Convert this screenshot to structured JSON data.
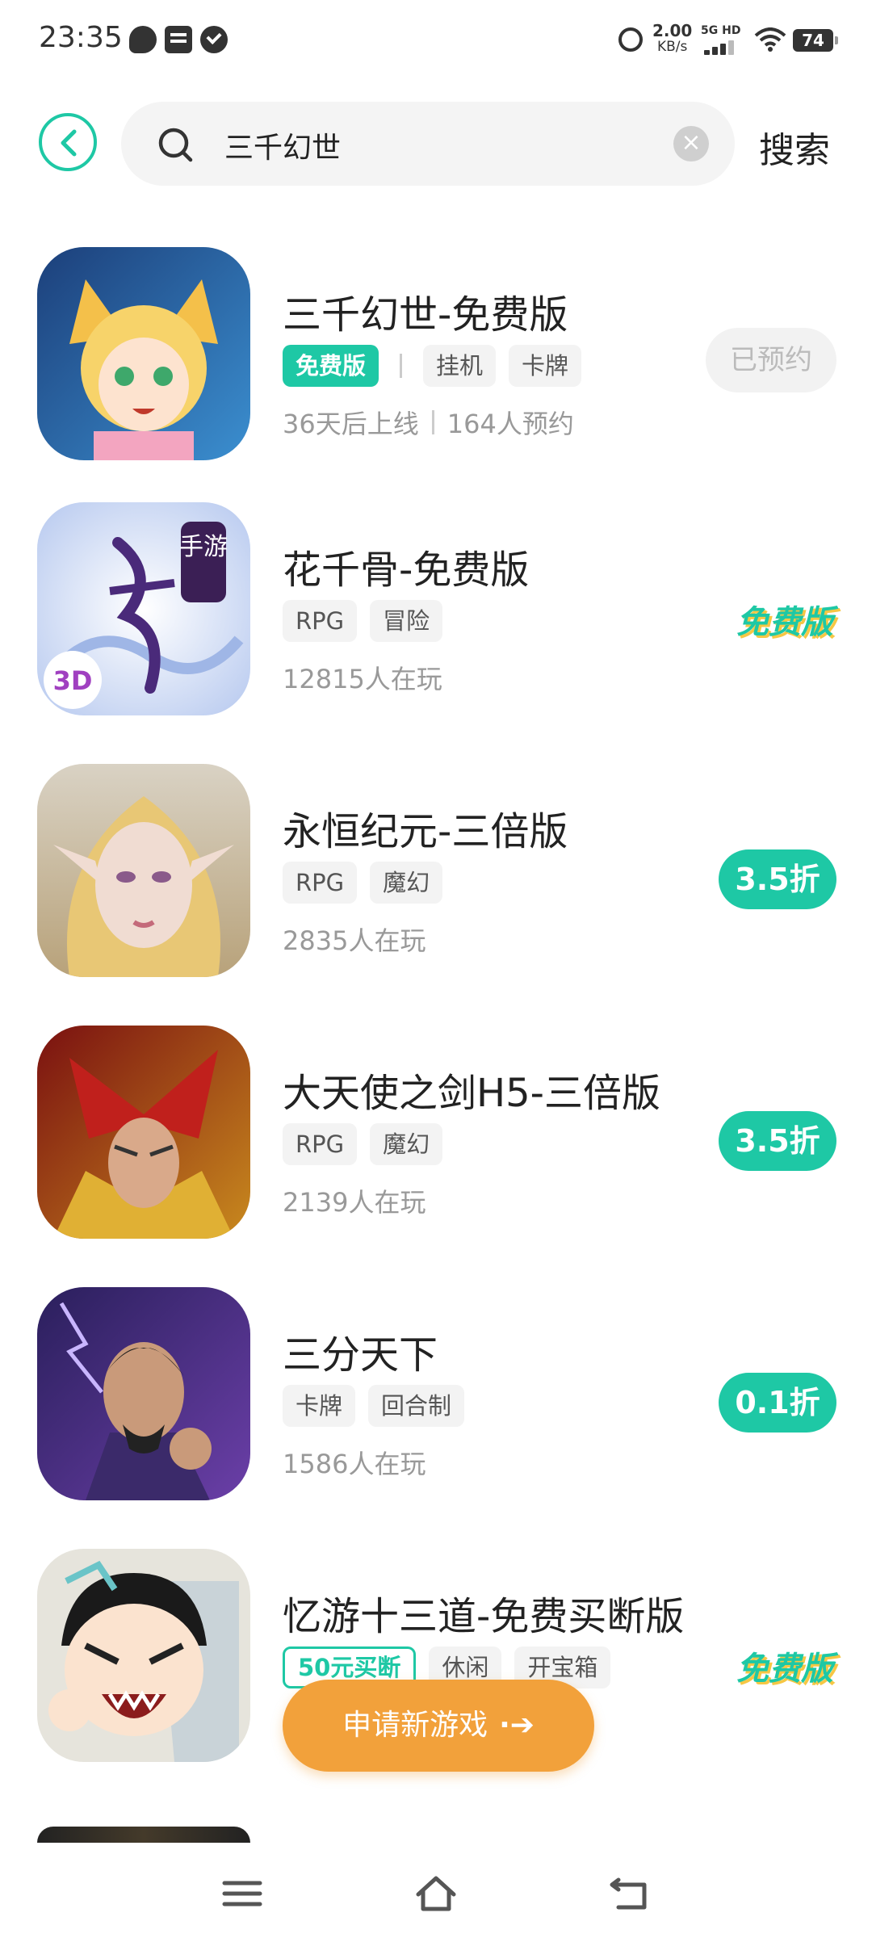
{
  "status_bar": {
    "time": "23:35",
    "net_speed_value": "2.00",
    "net_speed_unit": "KB/s",
    "net_type": "5G HD",
    "battery": "74"
  },
  "search": {
    "query": "三千幻世",
    "button_label": "搜索"
  },
  "accent_color": "#1ec8a5",
  "results": [
    {
      "title": "三千幻世-免费版",
      "tags": [
        "免费版",
        "挂机",
        "卡牌"
      ],
      "meta_1": "36天后上线",
      "meta_2": "164人预约",
      "action": "已预约"
    },
    {
      "title": "花千骨-免费版",
      "tags": [
        "RPG",
        "冒险"
      ],
      "meta_1": "12815人在玩",
      "action": "免费版",
      "icon_text_1": "手游",
      "icon_text_2": "3D"
    },
    {
      "title": "永恒纪元-三倍版",
      "tags": [
        "RPG",
        "魔幻"
      ],
      "meta_1": "2835人在玩",
      "action": "3.5折"
    },
    {
      "title": "大天使之剑H5-三倍版",
      "tags": [
        "RPG",
        "魔幻"
      ],
      "meta_1": "2139人在玩",
      "action": "3.5折"
    },
    {
      "title": "三分天下",
      "tags": [
        "卡牌",
        "回合制"
      ],
      "meta_1": "1586人在玩",
      "action": "0.1折"
    },
    {
      "title": "忆游十三道-免费买断版",
      "tags": [
        "50元买断",
        "休闲",
        "开宝箱"
      ],
      "action": "免费版"
    }
  ],
  "floating_button": {
    "label": "申请新游戏"
  }
}
